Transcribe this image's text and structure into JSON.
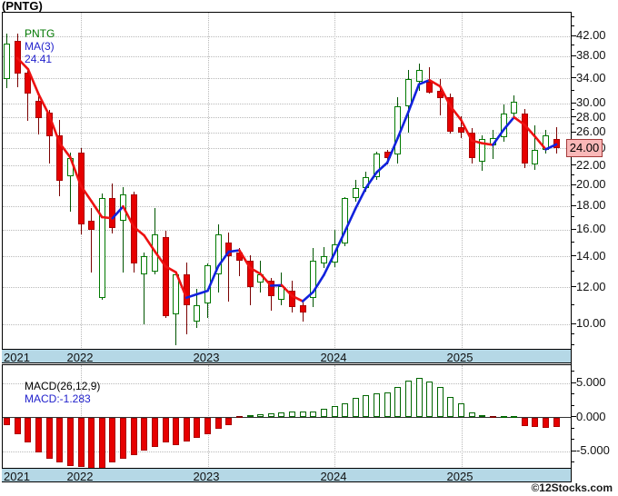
{
  "header": {
    "title": "(PNTG)"
  },
  "main_panel": {
    "symbol_label": "PNTG",
    "ma_label": "MA(3)",
    "ma_value": "24.41"
  },
  "macd_panel": {
    "label": "MACD(26,12,9)",
    "value_label": "MACD:-1.283"
  },
  "price_badge": "24.00",
  "watermark": "©12Stocks.com",
  "colors": {
    "up_border": "#007a00",
    "up_fill": "#ffffff",
    "down_fill": "#e60000",
    "down_border": "#aa0000",
    "wick_up": "#005500",
    "wick_down": "#7a0000",
    "ma_up": "#1122dd",
    "ma_down": "#ee1111",
    "band_bg": "#b5d8e6",
    "badge_bg": "#f9b8b8",
    "badge_border": "#a33a3a",
    "grid": "#b9b9b9",
    "zero_line": "#333333",
    "label_green": "#007700",
    "label_blue": "#2222cc"
  },
  "chart_data": {
    "type": "candlestick",
    "symbol": "PNTG",
    "interval": "monthly",
    "title": "(PNTG)",
    "y_axis": {
      "scale": "log",
      "major_ticks": [
        42,
        38,
        34,
        30,
        28,
        26,
        24,
        22,
        20,
        18,
        16,
        14,
        12,
        10
      ],
      "minor_ticks": [
        46,
        44,
        40,
        36,
        32,
        29,
        27,
        25,
        23,
        21,
        19,
        17,
        15,
        13,
        11,
        9.5,
        9
      ],
      "label_format": "0.00"
    },
    "x_axis": {
      "years": [
        "2021",
        "2022",
        "2023",
        "2024",
        "2025"
      ]
    },
    "overlays": [
      {
        "name": "MA(3)",
        "value": 24.41
      }
    ],
    "last_price": 24.0,
    "candles": [
      {
        "d": "2021-06",
        "o": 33.9,
        "h": 42.5,
        "l": 32.4,
        "c": 40.4
      },
      {
        "d": "2021-07",
        "o": 41.0,
        "h": 42.4,
        "l": 32.5,
        "c": 34.8
      },
      {
        "d": "2021-08",
        "o": 35.0,
        "h": 35.3,
        "l": 27.5,
        "c": 31.5
      },
      {
        "d": "2021-09",
        "o": 30.4,
        "h": 31.1,
        "l": 25.7,
        "c": 27.9
      },
      {
        "d": "2021-10",
        "o": 28.6,
        "h": 29.1,
        "l": 22.2,
        "c": 25.5
      },
      {
        "d": "2021-11",
        "o": 25.6,
        "h": 27.7,
        "l": 18.9,
        "c": 20.4
      },
      {
        "d": "2021-12",
        "o": 20.9,
        "h": 23.5,
        "l": 17.5,
        "c": 22.9
      },
      {
        "d": "2022-01",
        "o": 23.5,
        "h": 24.0,
        "l": 15.6,
        "c": 16.4
      },
      {
        "d": "2022-02",
        "o": 16.7,
        "h": 17.8,
        "l": 12.9,
        "c": 16.0
      },
      {
        "d": "2022-03",
        "o": 11.4,
        "h": 19.2,
        "l": 11.3,
        "c": 18.7
      },
      {
        "d": "2022-04",
        "o": 18.7,
        "h": 20.1,
        "l": 15.7,
        "c": 16.1
      },
      {
        "d": "2022-05",
        "o": 16.7,
        "h": 19.8,
        "l": 12.9,
        "c": 19.1
      },
      {
        "d": "2022-06",
        "o": 19.1,
        "h": 19.3,
        "l": 12.9,
        "c": 13.5
      },
      {
        "d": "2022-07",
        "o": 12.8,
        "h": 14.3,
        "l": 10.0,
        "c": 14.0
      },
      {
        "d": "2022-08",
        "o": 13.0,
        "h": 17.8,
        "l": 12.8,
        "c": 15.6
      },
      {
        "d": "2022-09",
        "o": 15.4,
        "h": 15.9,
        "l": 10.3,
        "c": 10.4
      },
      {
        "d": "2022-10",
        "o": 10.5,
        "h": 12.9,
        "l": 9.0,
        "c": 12.8
      },
      {
        "d": "2022-11",
        "o": 12.8,
        "h": 13.6,
        "l": 9.5,
        "c": 11.0
      },
      {
        "d": "2022-12",
        "o": 10.1,
        "h": 11.9,
        "l": 9.8,
        "c": 11.0
      },
      {
        "d": "2023-01",
        "o": 11.1,
        "h": 13.5,
        "l": 10.3,
        "c": 13.4
      },
      {
        "d": "2023-02",
        "o": 12.8,
        "h": 16.4,
        "l": 11.7,
        "c": 15.6
      },
      {
        "d": "2023-03",
        "o": 15.0,
        "h": 15.8,
        "l": 11.2,
        "c": 14.0
      },
      {
        "d": "2023-04",
        "o": 14.3,
        "h": 14.6,
        "l": 12.7,
        "c": 13.7
      },
      {
        "d": "2023-05",
        "o": 13.7,
        "h": 14.1,
        "l": 11.0,
        "c": 12.0
      },
      {
        "d": "2023-06",
        "o": 12.3,
        "h": 13.7,
        "l": 11.7,
        "c": 12.8
      },
      {
        "d": "2023-07",
        "o": 12.4,
        "h": 12.6,
        "l": 10.7,
        "c": 11.5
      },
      {
        "d": "2023-08",
        "o": 11.3,
        "h": 12.9,
        "l": 11.0,
        "c": 12.1
      },
      {
        "d": "2023-09",
        "o": 11.8,
        "h": 12.4,
        "l": 10.6,
        "c": 10.9
      },
      {
        "d": "2023-10",
        "o": 11.0,
        "h": 11.2,
        "l": 10.1,
        "c": 10.6
      },
      {
        "d": "2023-11",
        "o": 11.4,
        "h": 14.6,
        "l": 10.9,
        "c": 13.7
      },
      {
        "d": "2023-12",
        "o": 13.5,
        "h": 14.7,
        "l": 13.2,
        "c": 14.0
      },
      {
        "d": "2024-01",
        "o": 13.6,
        "h": 16.0,
        "l": 13.3,
        "c": 14.9
      },
      {
        "d": "2024-02",
        "o": 14.9,
        "h": 18.8,
        "l": 14.7,
        "c": 18.7
      },
      {
        "d": "2024-03",
        "o": 18.7,
        "h": 20.5,
        "l": 18.4,
        "c": 19.7
      },
      {
        "d": "2024-04",
        "o": 19.7,
        "h": 21.4,
        "l": 19.3,
        "c": 20.8
      },
      {
        "d": "2024-05",
        "o": 20.8,
        "h": 23.6,
        "l": 20.5,
        "c": 23.4
      },
      {
        "d": "2024-06",
        "o": 23.6,
        "h": 23.8,
        "l": 22.1,
        "c": 22.8
      },
      {
        "d": "2024-07",
        "o": 23.3,
        "h": 31.0,
        "l": 22.2,
        "c": 29.6
      },
      {
        "d": "2024-08",
        "o": 29.6,
        "h": 35.5,
        "l": 25.9,
        "c": 33.9
      },
      {
        "d": "2024-09",
        "o": 33.4,
        "h": 36.6,
        "l": 31.9,
        "c": 35.5
      },
      {
        "d": "2024-10",
        "o": 33.4,
        "h": 36.0,
        "l": 31.5,
        "c": 31.7
      },
      {
        "d": "2024-11",
        "o": 31.9,
        "h": 33.9,
        "l": 28.3,
        "c": 30.8
      },
      {
        "d": "2024-12",
        "o": 31.0,
        "h": 31.5,
        "l": 25.8,
        "c": 26.1
      },
      {
        "d": "2025-01",
        "o": 26.7,
        "h": 28.1,
        "l": 25.2,
        "c": 25.9
      },
      {
        "d": "2025-02",
        "o": 25.9,
        "h": 26.5,
        "l": 22.2,
        "c": 22.8
      },
      {
        "d": "2025-03",
        "o": 22.4,
        "h": 25.6,
        "l": 21.4,
        "c": 25.1
      },
      {
        "d": "2025-04",
        "o": 24.4,
        "h": 26.3,
        "l": 22.8,
        "c": 25.3
      },
      {
        "d": "2025-05",
        "o": 25.3,
        "h": 29.9,
        "l": 24.8,
        "c": 28.5
      },
      {
        "d": "2025-06",
        "o": 28.5,
        "h": 31.2,
        "l": 28.0,
        "c": 30.2
      },
      {
        "d": "2025-07",
        "o": 28.5,
        "h": 29.2,
        "l": 21.7,
        "c": 22.2
      },
      {
        "d": "2025-08",
        "o": 22.1,
        "h": 26.9,
        "l": 21.6,
        "c": 23.8
      },
      {
        "d": "2025-09",
        "o": 23.8,
        "h": 26.3,
        "l": 23.4,
        "c": 25.6
      },
      {
        "d": "2025-10",
        "o": 25.1,
        "h": 26.7,
        "l": 23.4,
        "c": 24.0
      }
    ],
    "macd": {
      "type": "histogram",
      "params": [
        26,
        12,
        9
      ],
      "value": -1.283,
      "y_ticks": [
        5.0,
        0.0,
        -5.0
      ],
      "minor_ticks": [
        6.67,
        3.33,
        1.67,
        -1.67,
        -3.33,
        -6.67
      ],
      "values": [
        -1.0,
        -2.3,
        -3.6,
        -5.0,
        -5.9,
        -6.5,
        -7.0,
        -7.2,
        -7.6,
        -7.4,
        -6.5,
        -5.9,
        -5.4,
        -4.8,
        -4.2,
        -3.6,
        -3.9,
        -3.4,
        -2.9,
        -2.4,
        -1.6,
        -1.0,
        -0.15,
        0.35,
        0.45,
        0.55,
        0.7,
        0.8,
        0.85,
        0.9,
        1.2,
        1.6,
        2.1,
        2.8,
        3.2,
        3.5,
        3.6,
        4.5,
        5.4,
        5.8,
        5.2,
        4.4,
        3.0,
        2.0,
        0.7,
        0.35,
        -0.1,
        0.05,
        0.15,
        -1.1,
        -1.3,
        -1.4,
        -1.283
      ]
    }
  }
}
